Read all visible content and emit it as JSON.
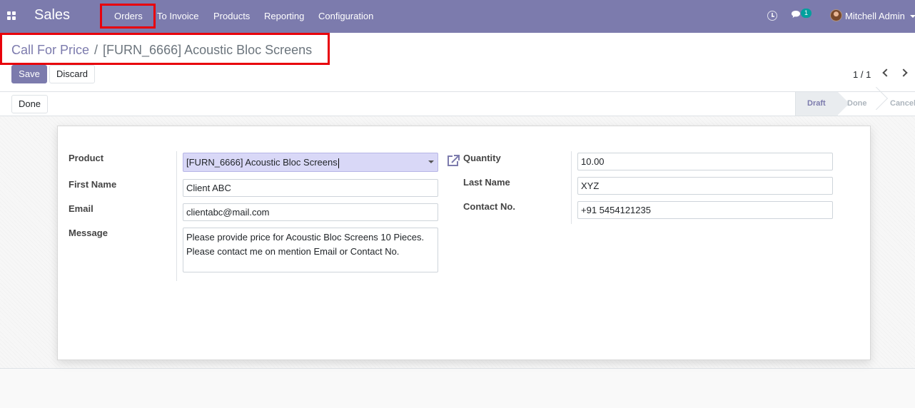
{
  "navbar": {
    "app_title": "Sales",
    "menu": [
      "Orders",
      "To Invoice",
      "Products",
      "Reporting",
      "Configuration"
    ],
    "chat_count": "1",
    "user_name": "Mitchell Admin",
    "accent": "#7c7bad"
  },
  "breadcrumb": {
    "parent": "Call For Price",
    "separator": "/",
    "current": "[FURN_6666] Acoustic Bloc Screens"
  },
  "toolbar": {
    "save_label": "Save",
    "discard_label": "Discard",
    "pager_value": "1 / 1"
  },
  "statusbar": {
    "done_button": "Done",
    "stages": [
      "Draft",
      "Done",
      "Cancel"
    ],
    "active_stage": "Draft"
  },
  "form": {
    "labels": {
      "product": "Product",
      "first_name": "First Name",
      "email": "Email",
      "message": "Message",
      "quantity": "Quantity",
      "last_name": "Last Name",
      "contact_no": "Contact No."
    },
    "values": {
      "product": "[FURN_6666] Acoustic Bloc Screens",
      "first_name": "Client ABC",
      "email": "clientabc@mail.com",
      "message": "Please provide price for Acoustic Bloc Screens 10 Pieces.\nPlease contact me on mention Email or Contact No.",
      "quantity": "10.00",
      "last_name": "XYZ",
      "contact_no": "+91 5454121235"
    }
  },
  "icons": {
    "apps": "apps-grid-icon",
    "activity": "clock-icon",
    "messages": "chat-icon",
    "external_link": "external-link-icon",
    "pager_prev": "chevron-left-icon",
    "pager_next": "chevron-right-icon"
  },
  "highlight_color": "#e8000b"
}
